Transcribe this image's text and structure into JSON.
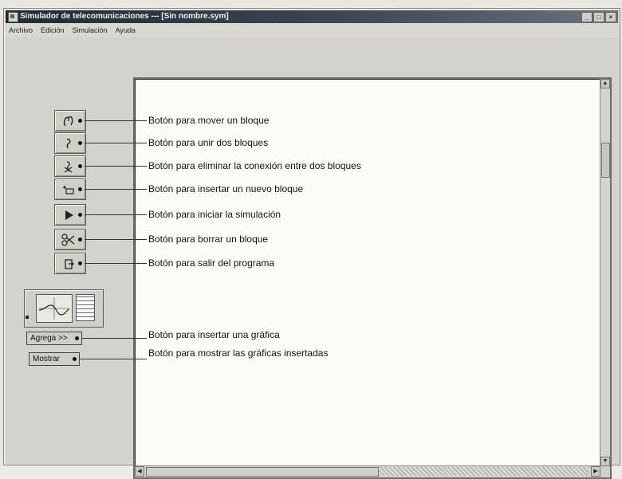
{
  "window": {
    "title": "Simulador de telecomunicaciones --- [Sin nombre.sym]",
    "controls": [
      "_",
      "□",
      "×"
    ]
  },
  "menu": {
    "items": [
      "Archivo",
      "Edición",
      "Simulación",
      "Ayuda"
    ]
  },
  "toolbar": {
    "buttons": [
      {
        "icon": "hand-move-icon",
        "label": "Botón para mover un bloque"
      },
      {
        "icon": "connect-icon",
        "label": "Botón para unir dos bloques"
      },
      {
        "icon": "disconnect-icon",
        "label": "Botón para eliminar la conexión entre dos bloques"
      },
      {
        "icon": "insert-block-icon",
        "label": "Botón para insertar un nuevo bloque"
      },
      {
        "icon": "play-icon",
        "label": "Botón para iniciar la simulación"
      },
      {
        "icon": "scissors-icon",
        "label": "Botón para borrar un bloque"
      },
      {
        "icon": "exit-icon",
        "label": "Botón para salir del programa"
      }
    ]
  },
  "graph_panel": {
    "add_button": "Agrega >>",
    "add_label": "Botón para insertar una gráfica",
    "show_button": "Mostrar",
    "show_label": "Botón para mostrar las gráficas insertadas"
  }
}
